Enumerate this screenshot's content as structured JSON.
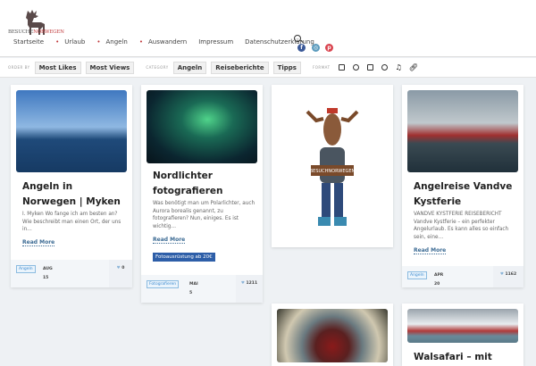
{
  "brand": {
    "name_a": "BESUCHE",
    "name_b": "NORWEGEN"
  },
  "nav": [
    {
      "label": "Startseite",
      "dot": false
    },
    {
      "label": "Urlaub",
      "dot": true
    },
    {
      "label": "Angeln",
      "dot": true
    },
    {
      "label": "Auswandern",
      "dot": true
    },
    {
      "label": "Impressum",
      "dot": false
    },
    {
      "label": "Datenschutzerklärung",
      "dot": false
    }
  ],
  "filters": {
    "order_by": "ORDER BY",
    "most_likes": "Most Likes",
    "most_views": "Most Views",
    "category": "CATEGORY",
    "cat_angeln": "Angeln",
    "cat_reiseberichte": "Reiseberichte",
    "cat_tipps": "Tipps",
    "format": "FORMAT"
  },
  "cards": [
    {
      "title": "Angeln in Norwegen | Myken",
      "excerpt": "I. Myken Wo fange ich am besten an? Wie beschreibt man einen Ort, der uns in…",
      "more": "Read More",
      "tag": "Angeln",
      "date_a": "AUG",
      "date_b": "15",
      "likes": "0"
    },
    {
      "title": "Nordlichter fotografieren",
      "excerpt": "Was benötigt man um Polarlichter, auch Aurora borealis genannt, zu fotografieren? Nun, einiges. Es ist wichtig…",
      "more": "Read More",
      "promo": "Fotoausrüstung   ab 20€",
      "tag": "Fotografieren",
      "date_a": "MAI",
      "date_b": "5",
      "likes": "1211"
    },
    {
      "sign": "BESUCHNORWEGEN"
    },
    {
      "title": "Angelreise Vandve Kystferie",
      "excerpt": "VANDVE KYSTFERIE REISEBERICHT Vandve Kystferie – ein perfekter Angelurlaub. Es kann alles so einfach sein, eine…",
      "more": "Read More",
      "tag": "Angeln",
      "date_a": "APR",
      "date_b": "20",
      "likes": "1162"
    },
    {},
    {
      "title": "Walsafari – mit"
    }
  ]
}
